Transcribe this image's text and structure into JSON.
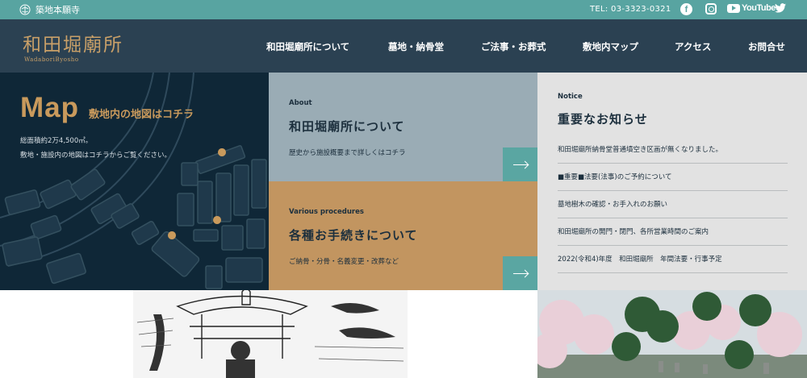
{
  "topbar": {
    "brand": "築地本願寺",
    "tel": "TEL: 03-3323-0321",
    "social": {
      "facebook_icon": "facebook-icon",
      "instagram_icon": "instagram-icon",
      "youtube_label": "YouTube",
      "twitter_icon": "twitter-icon"
    }
  },
  "header": {
    "title": "和田堀廟所",
    "subtitle": "WadaboriByosho",
    "nav": [
      "和田堀廟所について",
      "墓地・納骨堂",
      "ご法事・お葬式",
      "敷地内マップ",
      "アクセス",
      "お問合せ"
    ]
  },
  "map": {
    "title": "Map",
    "subtitle": "敷地内の地図はコチラ",
    "lines": [
      "総面積約2万4,500㎡。",
      "敷地・施設内の地図はコチラからご覧ください。"
    ]
  },
  "about": {
    "eyebrow": "About",
    "title": "和田堀廟所について",
    "desc": "歴史から施設概要まで詳しくはコチラ"
  },
  "procedures": {
    "eyebrow": "Various procedures",
    "title": "各種お手続きについて",
    "desc": "ご納骨・分骨・名義変更・改葬など"
  },
  "notice": {
    "eyebrow": "Notice",
    "title": "重要なお知らせ",
    "items": [
      "和田堀廟所納骨堂普通墳空き区画が無くなりました。",
      "■重要■法要(法事)のご予約について",
      "墓地樹木の確認・お手入れのお願い",
      "和田堀廟所の開門・閉門、各所営業時間のご案内",
      "2022(令和4)年度　和田堀廟所　年間法要・行事予定"
    ]
  },
  "colors": {
    "topbar": "#58a4a1",
    "header": "#2b4152",
    "gold": "#c99a5c",
    "map_bg": "#0f2737",
    "about_bg": "#9aacb5",
    "procedures_bg": "#c29560",
    "notice_bg": "#e2e2e2",
    "arrow_bg": "#5aa6a2"
  }
}
